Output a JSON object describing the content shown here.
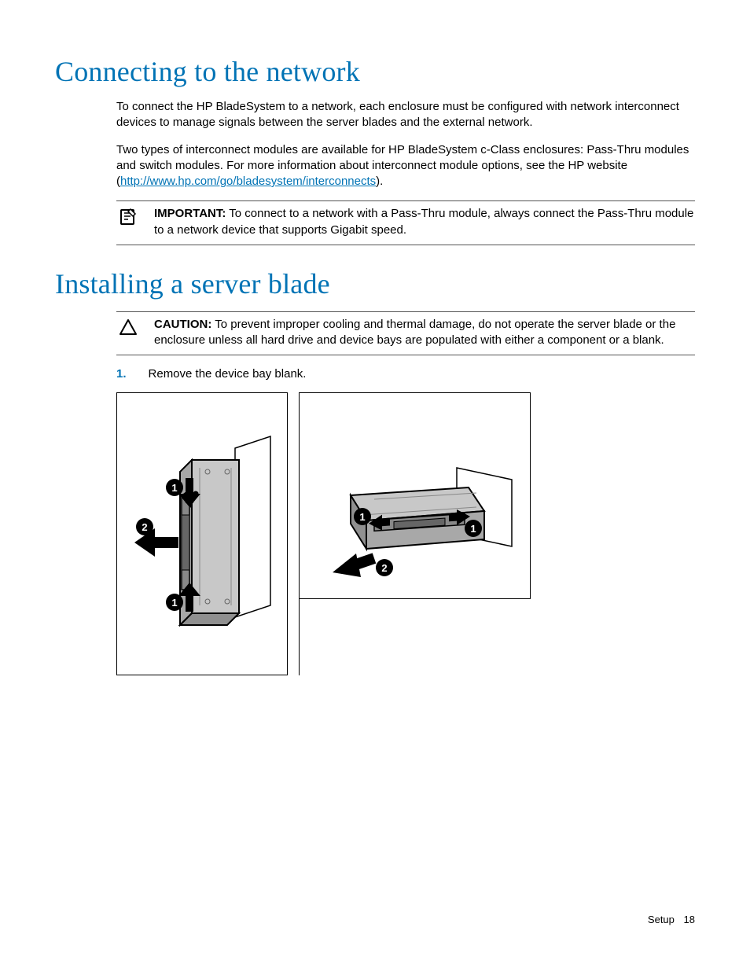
{
  "section1": {
    "heading": "Connecting to the network",
    "para1": "To connect the HP BladeSystem to a network, each enclosure must be configured with network interconnect devices to manage signals between the server blades and the external network.",
    "para2_pre": "Two types of interconnect modules are available for HP BladeSystem c-Class enclosures: Pass-Thru modules and switch modules. For more information about interconnect module options, see the HP website (",
    "para2_link": "http://www.hp.com/go/bladesystem/interconnects",
    "para2_post": ").",
    "important_label": "IMPORTANT:",
    "important_text": "  To connect to a network with a Pass-Thru module, always connect the Pass-Thru module to a network device that supports Gigabit speed."
  },
  "section2": {
    "heading": "Installing a server blade",
    "caution_label": "CAUTION:",
    "caution_text": "  To prevent improper cooling and thermal damage, do not operate the server blade or the enclosure unless all hard drive and device bays are populated with either a component or a blank.",
    "step1_num": "1.",
    "step1_text": "Remove the device bay blank."
  },
  "footer": {
    "section": "Setup",
    "page": "18"
  },
  "figure": {
    "labels": [
      "1",
      "2"
    ]
  }
}
